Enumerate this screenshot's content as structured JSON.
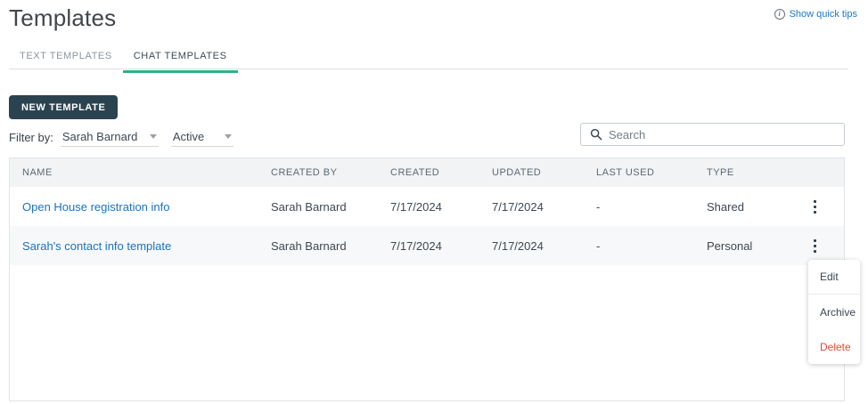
{
  "page": {
    "title": "Templates",
    "quick_tips_label": "Show quick tips"
  },
  "tabs": [
    {
      "label": "TEXT TEMPLATES",
      "active": false
    },
    {
      "label": "CHAT TEMPLATES",
      "active": true
    }
  ],
  "toolbar": {
    "new_template_label": "NEW TEMPLATE",
    "filter_label": "Filter by:",
    "filters": [
      {
        "name": "owner",
        "value": "Sarah Barnard"
      },
      {
        "name": "status",
        "value": "Active"
      }
    ],
    "search_placeholder": "Search"
  },
  "table": {
    "columns": [
      "NAME",
      "CREATED BY",
      "CREATED",
      "UPDATED",
      "LAST USED",
      "TYPE"
    ],
    "rows": [
      {
        "name": "Open House registration info",
        "created_by": "Sarah Barnard",
        "created": "7/17/2024",
        "updated": "7/17/2024",
        "last_used": "-",
        "type": "Shared"
      },
      {
        "name": "Sarah's contact info template",
        "created_by": "Sarah Barnard",
        "created": "7/17/2024",
        "updated": "7/17/2024",
        "last_used": "-",
        "type": "Personal"
      }
    ]
  },
  "context_menu": {
    "items": [
      {
        "label": "Edit",
        "danger": false
      },
      {
        "label": "Archive",
        "danger": false
      },
      {
        "label": "Delete",
        "danger": true
      }
    ]
  },
  "icons": {
    "info": "info-circle-icon",
    "search": "search-icon",
    "dropdown": "chevron-down-icon",
    "row_actions": "kebab-menu-icon"
  },
  "colors": {
    "accent_green": "#2ab384",
    "button_dark": "#2b4350",
    "link_blue": "#1b72bc",
    "danger_red": "#e24a35",
    "header_bg": "#f1f3f4",
    "alt_row_bg": "#f7f8f9"
  }
}
